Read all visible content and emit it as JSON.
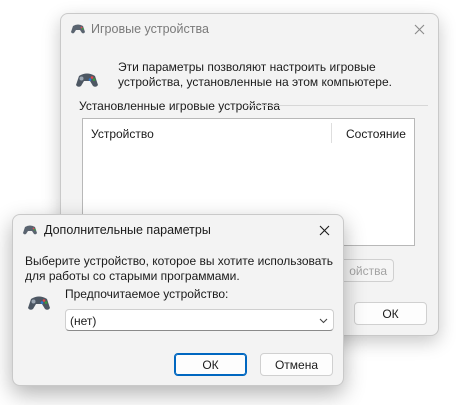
{
  "main_window": {
    "title": "Игровые устройства",
    "description": "Эти параметры позволяют настроить игровые устройства, установленные на этом компьютере.",
    "group_label": "Установленные игровые устройства",
    "columns": [
      "Устройство",
      "Состояние"
    ],
    "properties_button_partial": "ойства",
    "ok_button": "ОК"
  },
  "sub_window": {
    "title": "Дополнительные параметры",
    "description": "Выберите устройство, которое вы хотите использовать для работы со старыми программами.",
    "preferred_label": "Предпочитаемое устройство:",
    "preferred_value": "(нет)",
    "ok_button": "ОК",
    "cancel_button": "Отмена"
  },
  "icons": {
    "gamepad": "gamepad-icon",
    "close": "close-icon",
    "dropdown": "chevron-down-icon"
  },
  "colors": {
    "accent": "#0067c0"
  }
}
